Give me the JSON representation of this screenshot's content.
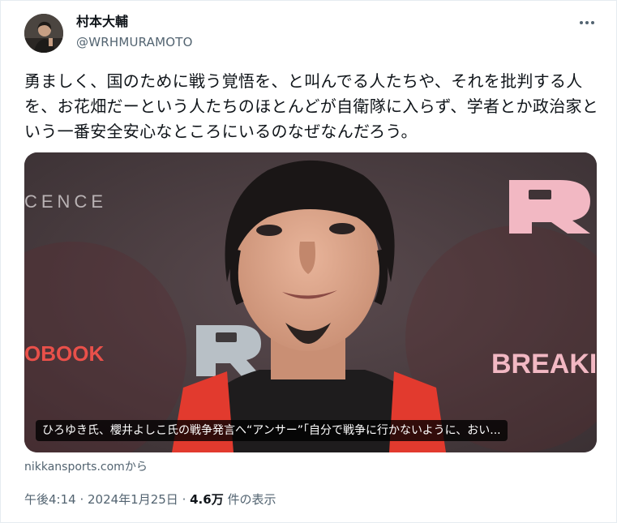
{
  "author": {
    "name": "村本大輔",
    "handle": "@WRHMURAMOTO"
  },
  "tweet": {
    "text": "勇ましく、国のために戦う覚悟を、と叫んでる人たちや、それを批判する人を、お花畑だーという人たちのほとんどが自衛隊に入らず、学者とか政治家という一番安全安心なところにいるのなぜなんだろう。"
  },
  "card": {
    "caption": "ひろゆき氏、櫻井よしこ氏の戦争発言へ“アンサー”「自分で戦争に行かないように、おい...",
    "backdrop_texts": [
      "CENCE",
      "OBOOK",
      "BREAKIN"
    ],
    "source": "nikkansports.comから"
  },
  "meta": {
    "time": "午後4:14",
    "sep1": " · ",
    "date": "2024年1月25日",
    "sep2": " · ",
    "views_count": "4.6万",
    "views_label": " 件の表示"
  },
  "icons": [
    "more-options-icon"
  ],
  "colors": {
    "text": "#0f1419",
    "secondary": "#536471",
    "caption_bg": "#000000",
    "backdrop": "#4a3d40",
    "sign_pink": "#f2b8c3"
  }
}
